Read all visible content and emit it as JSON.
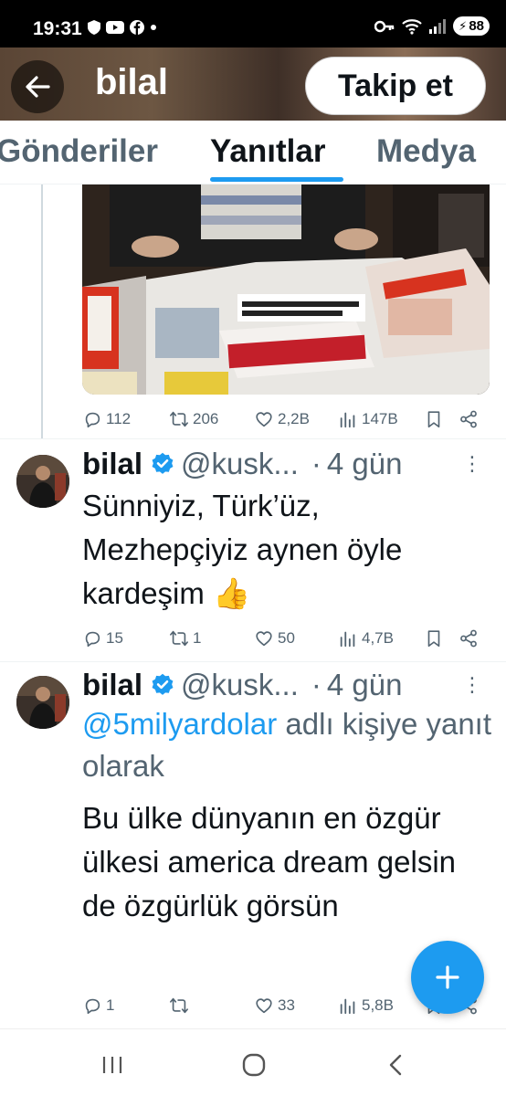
{
  "status_bar": {
    "time": "19:31",
    "battery": "88",
    "left_icons": [
      "shield-icon",
      "youtube-icon",
      "facebook-icon",
      "dot-icon"
    ],
    "right_icons": [
      "key-icon",
      "wifi-icon",
      "signal-icon",
      "battery-icon"
    ]
  },
  "header": {
    "back_icon": "arrow-left-icon",
    "name": "bilal",
    "follow_label": "Takip et"
  },
  "tabs": [
    {
      "label": "Gönderiler",
      "active": false
    },
    {
      "label": "Yanıtlar",
      "active": true
    },
    {
      "label": "Medya",
      "active": false
    }
  ],
  "tweets": [
    {
      "media_description_icon": "newspapers-photo",
      "actions": {
        "replies": "112",
        "retweets": "206",
        "likes": "2,2B",
        "views": "147B"
      }
    },
    {
      "name": "bilal",
      "handle": "@kusk...",
      "dot": "·",
      "time": "4 gün",
      "text": "Sünniyiz, Türk’üz, Mezhepçiyiz aynen öyle kardeşim 👍",
      "actions": {
        "replies": "15",
        "retweets": "1",
        "likes": "50",
        "views": "4,7B"
      }
    },
    {
      "name": "bilal",
      "handle": "@kusk...",
      "dot": "·",
      "time": "4 gün",
      "reply_to_mention": "@5milyardolar",
      "reply_to_suffix": " adlı kişiye yanıt olarak",
      "text": "Bu ülke dünyanın en özgür ülkesi america dream gelsin de özgürlük görsün",
      "actions": {
        "replies": "1",
        "retweets": "",
        "likes": "33",
        "views": "5,8B"
      }
    }
  ],
  "fab_icon": "plus-icon",
  "colors": {
    "accent": "#1d9bf0",
    "muted": "#536471",
    "text": "#0f1419"
  }
}
